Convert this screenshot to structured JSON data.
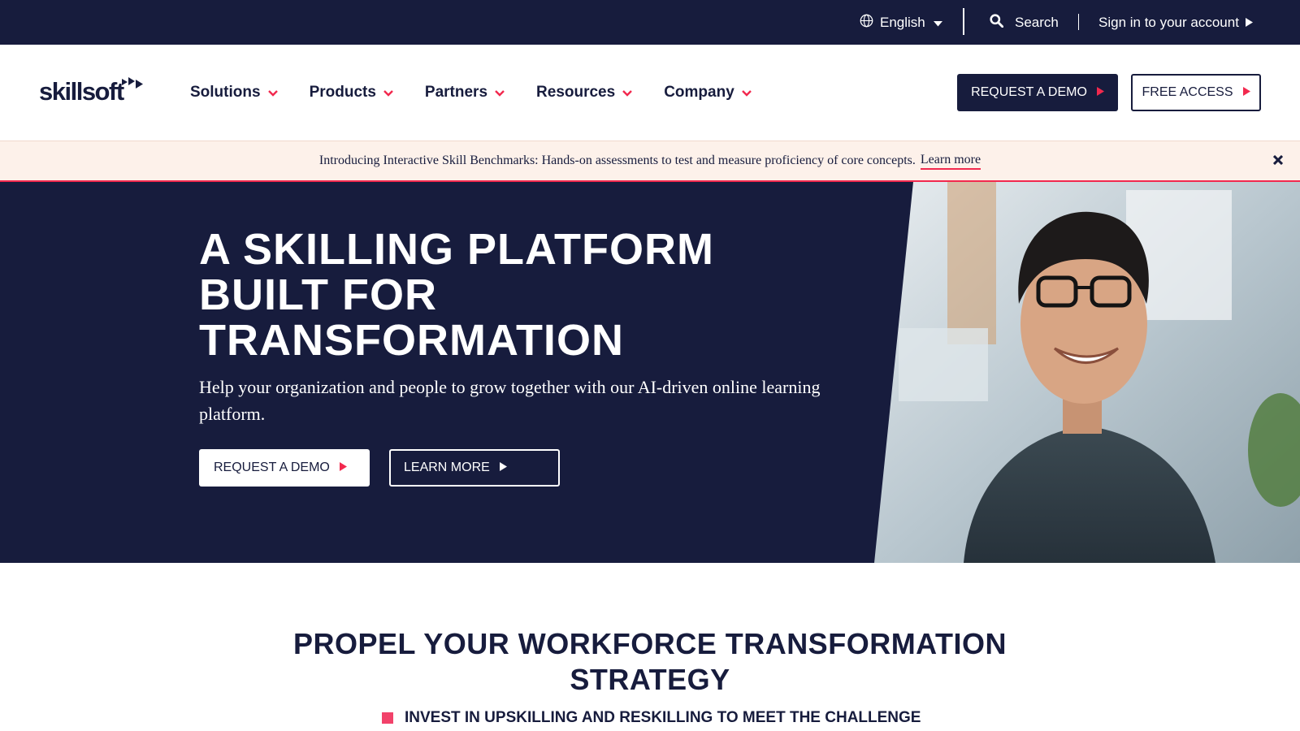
{
  "utility": {
    "language": "English",
    "search": "Search",
    "signin": "Sign in to your account"
  },
  "brand": {
    "name": "skillsoft"
  },
  "nav": {
    "items": [
      {
        "label": "Solutions"
      },
      {
        "label": "Products"
      },
      {
        "label": "Partners"
      },
      {
        "label": "Resources"
      },
      {
        "label": "Company"
      }
    ],
    "request_demo": "REQUEST A DEMO",
    "free_access": "FREE ACCESS"
  },
  "announcement": {
    "text": "Introducing Interactive Skill Benchmarks: Hands-on assessments to test and measure proficiency of core concepts.",
    "link": "Learn more"
  },
  "hero": {
    "title_line1": "A SKILLING PLATFORM",
    "title_line2": "BUILT FOR",
    "title_line3": "TRANSFORMATION",
    "subtitle": "Help your organization and people to grow together with our AI-driven online learning platform.",
    "cta_demo": "REQUEST A DEMO",
    "cta_learn": "LEARN MORE"
  },
  "section": {
    "title_line1": "PROPEL YOUR WORKFORCE TRANSFORMATION",
    "title_line2": "STRATEGY",
    "subtitle": "INVEST IN UPSKILLING AND RESKILLING TO MEET THE CHALLENGE"
  },
  "colors": {
    "navy": "#171c3d",
    "accent": "#f2294e",
    "banner_bg": "#fdf1ea"
  },
  "icons": [
    "globe-icon",
    "caret-down-icon",
    "search-icon",
    "play-triangle-icon",
    "chevron-down-icon",
    "close-icon"
  ]
}
